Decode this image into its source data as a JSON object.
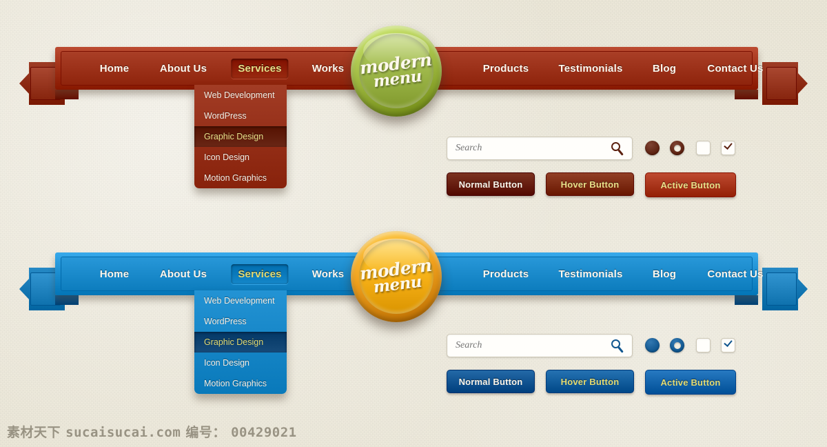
{
  "page": {
    "background_color": "#eae5d5",
    "watermark": {
      "site_prefix": "素材天下",
      "site": "sucaisucai.com",
      "id_label": "编号：",
      "id_value": "00429021"
    }
  },
  "menus": [
    {
      "id": "red-menu",
      "theme": "red",
      "colors": {
        "bar": "#a23218",
        "bar_inner": "#9c3119",
        "tail": "#8c2a13",
        "fold": "#7a2410",
        "dropdown": "#963019",
        "dropdown_active": "#5d1a09",
        "accent_text": "#e9e08a",
        "badge_outer": "#a8c24a",
        "badge_inner": "#9fb84b",
        "control": "#5c2110",
        "btn_normal": "#661d0b",
        "btn_hover": "#7c2a10",
        "btn_active": "#a8341a"
      },
      "nav": [
        {
          "label": "Home",
          "active": false
        },
        {
          "label": "About Us",
          "active": false
        },
        {
          "label": "Services",
          "active": true
        },
        {
          "label": "Works",
          "active": false
        },
        {
          "label": "Products",
          "active": false
        },
        {
          "label": "Testimonials",
          "active": false
        },
        {
          "label": "Blog",
          "active": false
        },
        {
          "label": "Contact Us",
          "active": false
        }
      ],
      "dropdown": [
        {
          "label": "Web Development",
          "active": false
        },
        {
          "label": "WordPress",
          "active": false
        },
        {
          "label": "Graphic Design",
          "active": true
        },
        {
          "label": "Icon Design",
          "active": false
        },
        {
          "label": "Motion Graphics",
          "active": false
        }
      ],
      "badge": {
        "line1": "modern",
        "line2": "menu"
      },
      "search": {
        "placeholder": "Search",
        "value": "",
        "icon": "search-icon"
      },
      "controls": {
        "radio_filled": "radio-selected",
        "radio_donut": "radio-ring",
        "checkbox_empty": "checkbox-unchecked",
        "checkbox_checked": "checkbox-checked"
      },
      "buttons": [
        {
          "label": "Normal Button",
          "state": "normal"
        },
        {
          "label": "Hover Button",
          "state": "hover"
        },
        {
          "label": "Active Button",
          "state": "active"
        }
      ]
    },
    {
      "id": "blue-menu",
      "theme": "blue",
      "colors": {
        "bar": "#1d8fd1",
        "bar_inner": "#1a8acb",
        "tail": "#1477b3",
        "fold": "#10568a",
        "dropdown": "#1787c8",
        "dropdown_active": "#0b3f6e",
        "accent_text": "#e4dc74",
        "badge_outer": "#f5a623",
        "badge_inner": "#f8b219",
        "control": "#10568f",
        "btn_normal": "#0d5391",
        "btn_hover": "#0f5c9c",
        "btn_active": "#1163ab"
      },
      "nav": [
        {
          "label": "Home",
          "active": false
        },
        {
          "label": "About Us",
          "active": false
        },
        {
          "label": "Services",
          "active": true
        },
        {
          "label": "Works",
          "active": false
        },
        {
          "label": "Products",
          "active": false
        },
        {
          "label": "Testimonials",
          "active": false
        },
        {
          "label": "Blog",
          "active": false
        },
        {
          "label": "Contact Us",
          "active": false
        }
      ],
      "dropdown": [
        {
          "label": "Web Development",
          "active": false
        },
        {
          "label": "WordPress",
          "active": false
        },
        {
          "label": "Graphic Design",
          "active": true
        },
        {
          "label": "Icon Design",
          "active": false
        },
        {
          "label": "Motion Graphics",
          "active": false
        }
      ],
      "badge": {
        "line1": "modern",
        "line2": "menu"
      },
      "search": {
        "placeholder": "Search",
        "value": "",
        "icon": "search-icon"
      },
      "controls": {
        "radio_filled": "radio-selected",
        "radio_donut": "radio-ring",
        "checkbox_empty": "checkbox-unchecked",
        "checkbox_checked": "checkbox-checked"
      },
      "buttons": [
        {
          "label": "Normal Button",
          "state": "normal"
        },
        {
          "label": "Hover Button",
          "state": "hover"
        },
        {
          "label": "Active Button",
          "state": "active"
        }
      ]
    }
  ]
}
